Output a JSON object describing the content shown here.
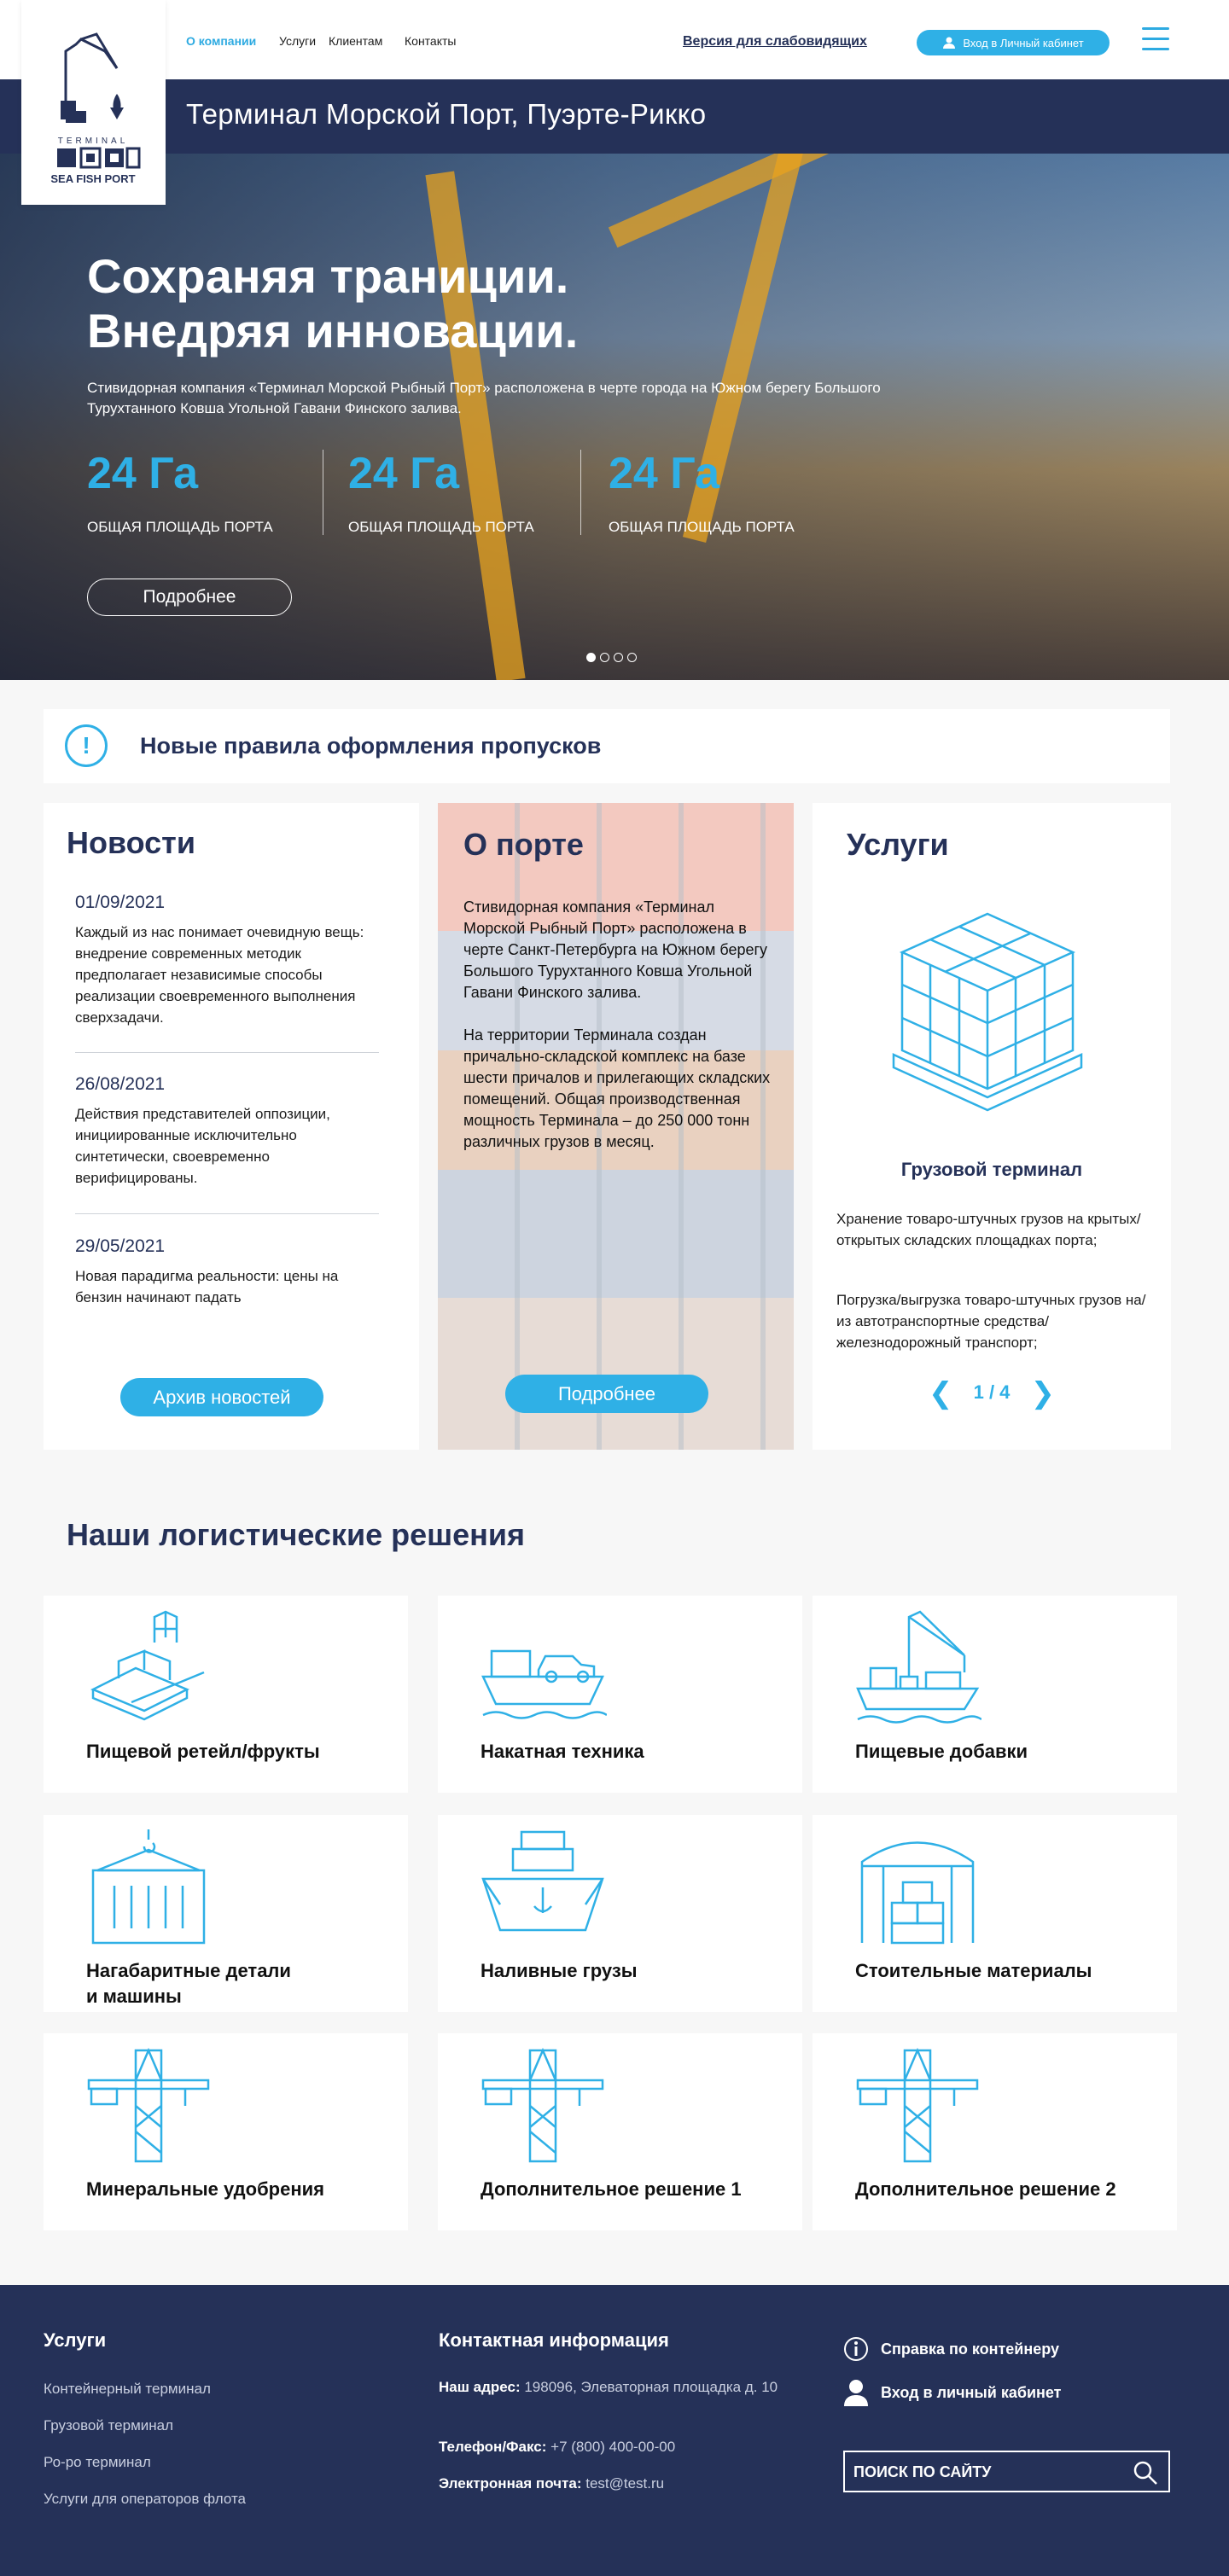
{
  "header": {
    "nav": [
      "О компании",
      "Услуги",
      "Клиентам",
      "Контакты"
    ],
    "accessibility_link": "Версия для слабовидящих",
    "login_button": "Вход в Личный кабинет",
    "logo": {
      "top_text": "TERMINAL",
      "bottom_text": "SEA FISH PORT"
    },
    "page_title": "Терминал Морской  Порт, Пуэрте-Рикко"
  },
  "hero": {
    "title_line1": "Сохраняя траниции.",
    "title_line2": "Внедряя инновации.",
    "description": "Стивидорная компания «Терминал Морской Рыбный Порт» расположена в черте города на Южном берегу Большого Турухтанного Ковша Угольной Гавани Финского залива.",
    "stats": [
      {
        "value": "24 Га",
        "label": "ОБЩАЯ ПЛОЩАДЬ  ПОРТА"
      },
      {
        "value": "24 Га",
        "label": "ОБЩАЯ ПЛОЩАДЬ ПОРТА"
      },
      {
        "value": "24 Га",
        "label": "ОБЩАЯ ПЛОЩАДЬ ПОРТА"
      }
    ],
    "button": "Подробнее",
    "slides_total": 4,
    "slide_active": 1
  },
  "alert": {
    "text": "Новые правила оформления пропусков"
  },
  "news": {
    "title": "Новости",
    "items": [
      {
        "date": "01/09/2021",
        "text": "Каждый из нас понимает очевидную вещь: внедрение современных методик предполагает независимые способы реализации своевременного выполнения сверхзадачи."
      },
      {
        "date": "26/08/2021",
        "text": "Действия представителей оппозиции, инициированные исключительно синтетически, своевременно верифицированы."
      },
      {
        "date": "29/05/2021",
        "text": "Новая парадигма реальности: цены на бензин начинают падать"
      }
    ],
    "archive_button": "Архив новостей"
  },
  "about": {
    "title": "О порте",
    "paragraph1": "Стивидорная компания «Терминал Морской Рыбный Порт» расположена в черте Санкт-Петербурга на Южном берегу Большого Турухтанного Ковша Угольной Гавани Финского залива.",
    "paragraph2": "На территории Терминала создан причально-складской комплекс на базе шести причалов и прилегающих складских помещений. Общая производственная мощность Терминала – до 250 000 тонн различных грузов в месяц.",
    "button": "Подробнее"
  },
  "services": {
    "title": "Услуги",
    "item_title": "Грузовой терминал",
    "paragraph1": "Хранение товаро-штучных грузов на крытых/открытых складских площадках порта;",
    "paragraph2": "Погрузка/выгрузка товаро-штучных грузов на/из автотранспортные средства/железнодорожный транспорт;",
    "pager": "1 / 4"
  },
  "logistics": {
    "title": "Наши логистические решения",
    "tiles": [
      {
        "label": "Пищевой ретейл/фрукты",
        "icon": "ship-container-icon"
      },
      {
        "label": "Накатная техника",
        "icon": "car-ferry-icon"
      },
      {
        "label": "Пищевые добавки",
        "icon": "crane-ship-icon"
      },
      {
        "label": "Нагабаритные детали\nи машины",
        "icon": "hook-container-icon"
      },
      {
        "label": "Наливные грузы",
        "icon": "tanker-ship-icon"
      },
      {
        "label": "Стоительные материалы",
        "icon": "warehouse-icon"
      },
      {
        "label": "Минеральные удобрения",
        "icon": "tower-crane-icon"
      },
      {
        "label": "Дополнительное решение 1",
        "icon": "tower-crane-icon"
      },
      {
        "label": "Дополнительное решение 2",
        "icon": "tower-crane-icon"
      }
    ]
  },
  "footer": {
    "services_title": "Услуги",
    "services_links": [
      "Контейнерный терминал",
      "Грузовой терминал",
      "Ро-ро терминал",
      "Услуги для операторов флота"
    ],
    "contacts_title": "Контактная информация",
    "address_label": "Наш адрес:",
    "address_value": "198096, Элеваторная площадка д. 10",
    "phone_label": "Телефон/Факс:",
    "phone_value": "+7 (800) 400-00-00",
    "email_label": "Электронная почта:",
    "email_value": "test@test.ru",
    "container_help": "Справка по контейнеру",
    "cabinet_login": "Вход в личный кабинет",
    "search_placeholder": "ПОИСК ПО САЙТУ"
  },
  "colors": {
    "navy": "#253158",
    "accent": "#2fb0e6",
    "background": "#f7f7f7"
  }
}
